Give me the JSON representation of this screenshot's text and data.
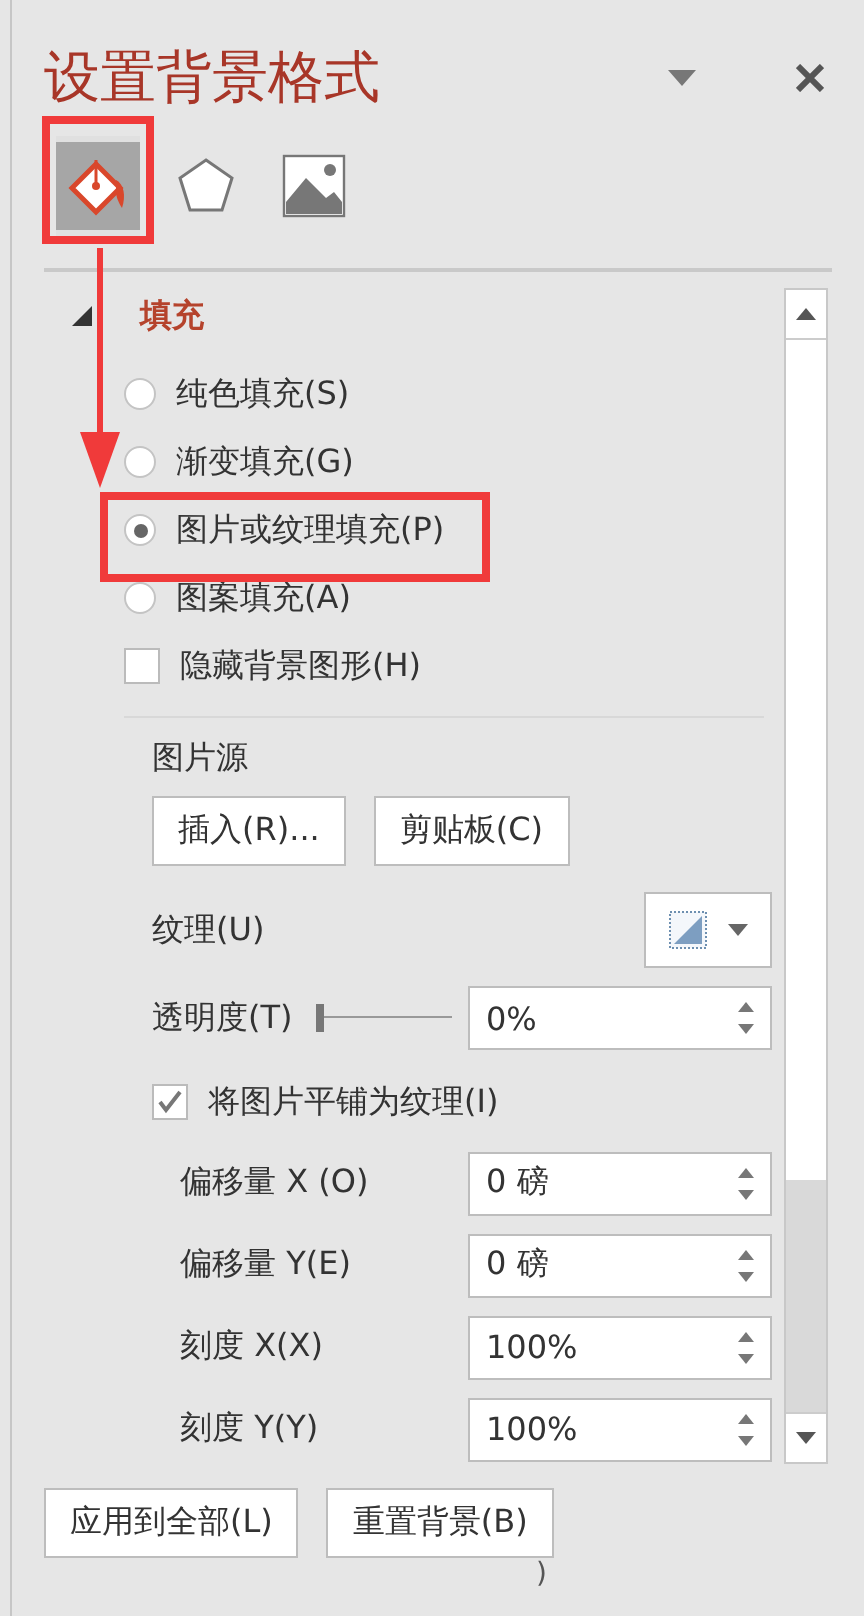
{
  "title": "设置背景格式",
  "tabs": [
    {
      "kind": "fill",
      "selected": true
    },
    {
      "kind": "effects",
      "selected": false
    },
    {
      "kind": "picture",
      "selected": false
    }
  ],
  "section": {
    "title": "填充",
    "expanded": true
  },
  "fill_options": [
    {
      "label": "纯色填充(S)",
      "selected": false
    },
    {
      "label": "渐变填充(G)",
      "selected": false
    },
    {
      "label": "图片或纹理填充(P)",
      "selected": true
    },
    {
      "label": "图案填充(A)",
      "selected": false
    }
  ],
  "hide_background": {
    "label": "隐藏背景图形(H)",
    "checked": false
  },
  "picture_source": {
    "label": "图片源",
    "buttons": [
      "插入(R)...",
      "剪贴板(C)"
    ]
  },
  "texture": {
    "label": "纹理(U)"
  },
  "transparency": {
    "label": "透明度(T)",
    "level": 0,
    "value": "0%"
  },
  "tile": {
    "label": "将图片平铺为纹理(I)",
    "checked": true
  },
  "fields": [
    {
      "label": "偏移量 X (O)",
      "value": "0 磅"
    },
    {
      "label": "偏移量 Y(E)",
      "value": "0 磅"
    },
    {
      "label": "刻度 X(X)",
      "value": "100%"
    },
    {
      "label": "刻度 Y(Y)",
      "value": "100%"
    }
  ],
  "footer_buttons": [
    "应用到全部(L)",
    "重置背景(B)"
  ],
  "stray_text": ")"
}
